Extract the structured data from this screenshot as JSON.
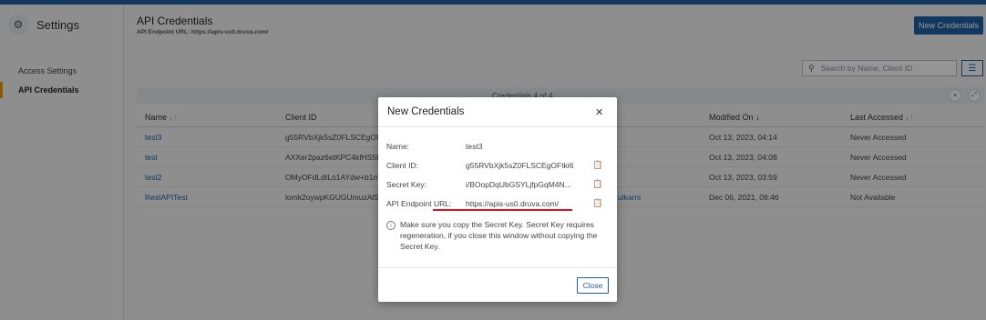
{
  "sidebar": {
    "title": "Settings",
    "icon": "gear-icon",
    "items": [
      {
        "label": "Access Settings"
      },
      {
        "label": "API Credentials"
      }
    ]
  },
  "header": {
    "title": "API Credentials",
    "subtitle": "API Endpoint URL: https://apis-us0.druva.com/",
    "new_button": "New Credentials"
  },
  "toolbar": {
    "search_placeholder": "Search by Name, Client ID"
  },
  "table": {
    "count_label": "Credentials   4 of 4",
    "columns": [
      "Name",
      "Client ID",
      "Modified On",
      "Last Accessed"
    ],
    "rows": [
      {
        "name": "test3",
        "client_id": "g55RVbXjk5sZ0FLSCEgOFtki",
        "created_by": "",
        "modified": "Oct 13, 2023, 04:14",
        "last_accessed": "Never Accessed"
      },
      {
        "name": "test",
        "client_id": "AXXer2paz6etKPC4kfHS5HD",
        "created_by": "",
        "modified": "Oct 13, 2023, 04:08",
        "last_accessed": "Never Accessed"
      },
      {
        "name": "test2",
        "client_id": "OMyOFdLdtLo1AYdw+b1mq",
        "created_by": "",
        "modified": "Oct 13, 2023, 03:59",
        "last_accessed": "Never Accessed"
      },
      {
        "name": "RestAPITest",
        "client_id": "lomk2oywpKGUGUmuzAlSF",
        "created_by": "ulkarni",
        "modified": "Dec 06, 2021, 08:46",
        "last_accessed": "Not Available"
      }
    ]
  },
  "modal": {
    "title": "New Credentials",
    "fields": [
      {
        "label": "Name:",
        "value": "test3"
      },
      {
        "label": "Client ID:",
        "value": "g55RVbXjk5sZ0FLSCEgOFtki6..."
      },
      {
        "label": "Secret Key:",
        "value": "i/BOopDqUbGSYLjfpGqM4N..."
      },
      {
        "label": "API Endpoint URL:",
        "value": "https://apis-us0.druva.com/"
      }
    ],
    "info": "Make sure you copy the Secret Key. Secret Key requires regeneration, if you close this window without copying the Secret Key.",
    "close_button": "Close"
  },
  "colors": {
    "accent": "#1f5fa5",
    "sidebar_active": "#e8a000",
    "highlight": "#d9141f"
  }
}
